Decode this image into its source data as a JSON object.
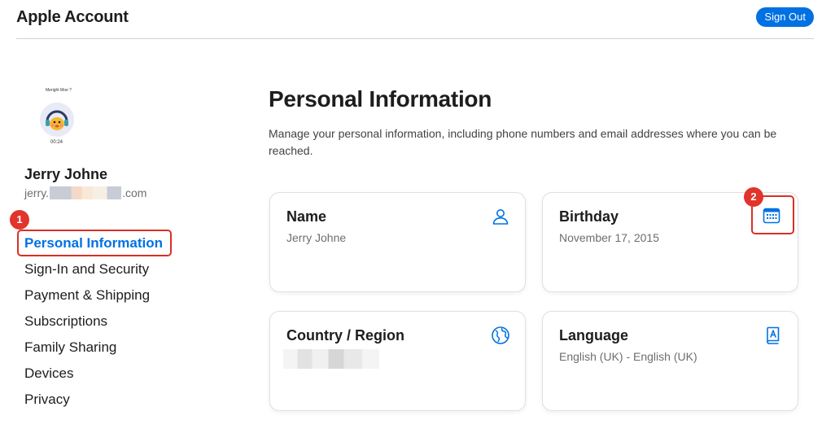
{
  "header": {
    "title": "Apple Account",
    "sign_out_label": "Sign Out"
  },
  "profile": {
    "avatar_top_text": "Meright Moe ?",
    "avatar_time": "00:24",
    "name": "Jerry Johne",
    "email_prefix": "jerry.",
    "email_suffix": ".com"
  },
  "sidebar": {
    "items": [
      {
        "label": "Personal Information",
        "active": true
      },
      {
        "label": "Sign-In and Security",
        "active": false
      },
      {
        "label": "Payment & Shipping",
        "active": false
      },
      {
        "label": "Subscriptions",
        "active": false
      },
      {
        "label": "Family Sharing",
        "active": false
      },
      {
        "label": "Devices",
        "active": false
      },
      {
        "label": "Privacy",
        "active": false
      }
    ]
  },
  "main": {
    "title": "Personal Information",
    "description": "Manage your personal information, including phone numbers and email addresses where you can be reached.",
    "cards": [
      {
        "title": "Name",
        "value": "Jerry Johne",
        "icon": "person-icon"
      },
      {
        "title": "Birthday",
        "value": "November 17, 2015",
        "icon": "calendar-icon"
      },
      {
        "title": "Country / Region",
        "value": "",
        "icon": "globe-icon"
      },
      {
        "title": "Language",
        "value": "English (UK) - English (UK)",
        "icon": "book-icon"
      }
    ]
  },
  "annotations": {
    "marker_1": "1",
    "marker_2": "2"
  },
  "colors": {
    "accent": "#0071e3",
    "highlight": "#d93025",
    "text": "#1d1d1f",
    "secondary_text": "#6e6e73"
  }
}
